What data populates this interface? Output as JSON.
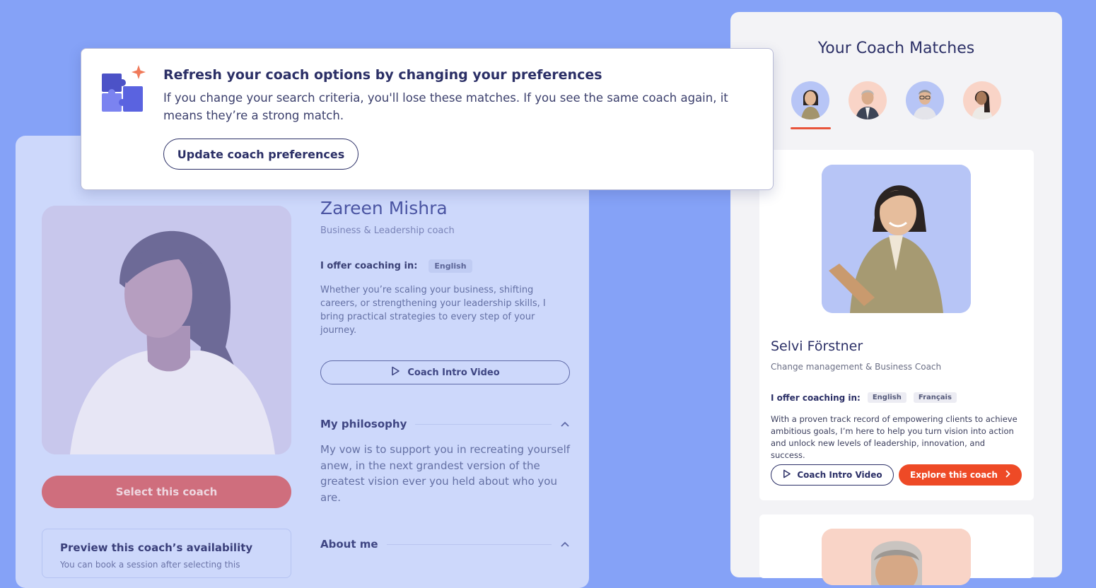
{
  "popup": {
    "title": "Refresh your coach options by changing your preferences",
    "body": "If you change your search criteria, you'll lose these matches. If you see the same coach again, it means they’re a strong match.",
    "button_label": "Update coach preferences",
    "icon": "puzzle-sparkle-icon"
  },
  "profile": {
    "name": "Zareen Mishra",
    "role": "Business & Leadership coach",
    "offer_label": "I offer coaching in:",
    "languages": [
      "English"
    ],
    "bio": "Whether you’re scaling your business, shifting careers, or strengthening your leadership skills, I bring practical strategies to every step of your journey.",
    "intro_video_label": "Coach Intro Video",
    "select_label": "Select this coach",
    "availability_title": "Preview this coach’s availability",
    "availability_sub": "You can book a session after selecting this",
    "philosophy_title": "My philosophy",
    "philosophy_text": "My vow is to support you in recreating yourself anew, in the next grandest version of the greatest vision ever you held about who you are.",
    "about_title": "About me"
  },
  "matches": {
    "title": "Your Coach Matches",
    "selected_index": 0,
    "card": {
      "name": "Selvi Förstner",
      "role": "Change management & Business Coach",
      "offer_label": "I offer coaching in:",
      "languages": [
        "English",
        "Français"
      ],
      "bio": "With a proven track record of empowering clients to achieve ambitious goals, I’m here to help you turn vision into action and unlock new levels of leadership, innovation, and success.",
      "intro_video_label": "Coach Intro Video",
      "explore_label": "Explore this coach"
    }
  },
  "colors": {
    "background": "#85a2f7",
    "accent": "#ee4a26",
    "navy": "#2b2f66",
    "select_button": "#cf6e7d"
  }
}
